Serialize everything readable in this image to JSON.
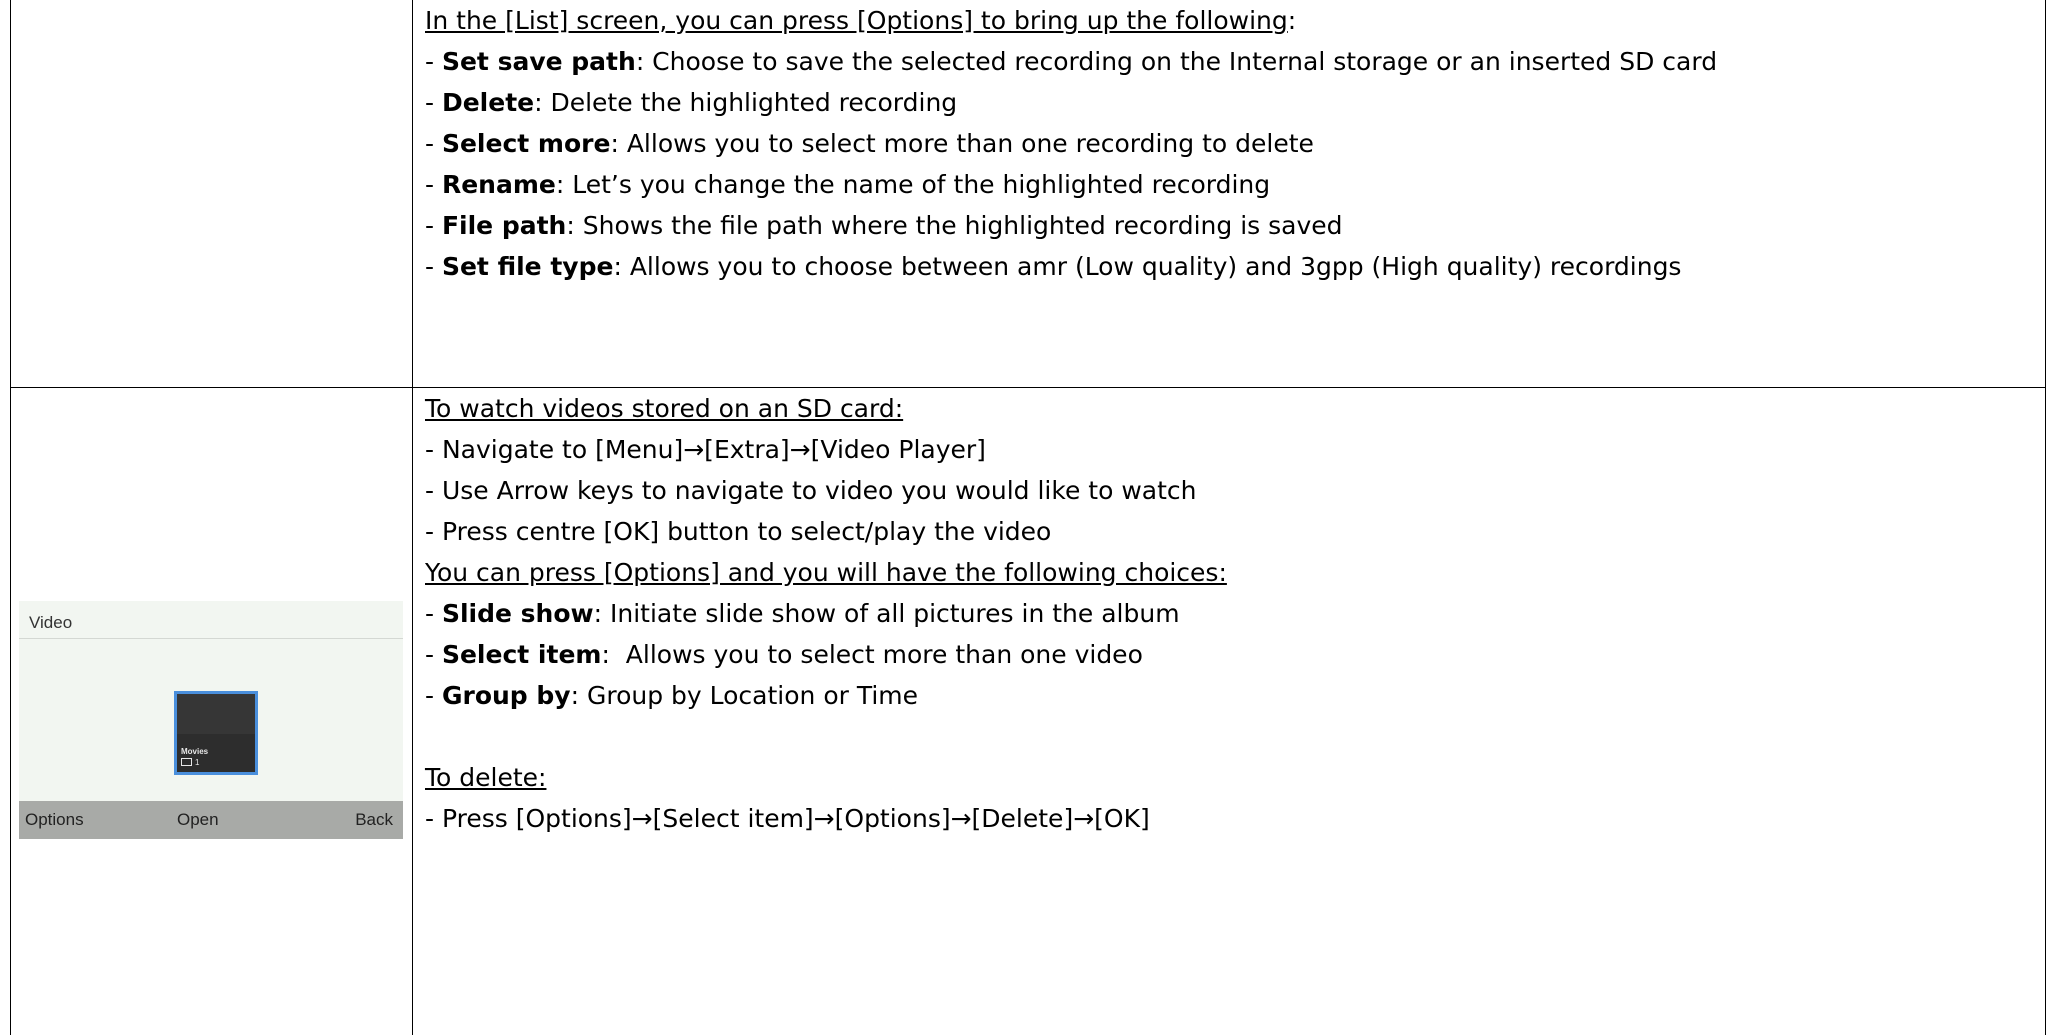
{
  "row1": {
    "lines": [
      {
        "type": "underlined",
        "text": "In the [List] screen, you can press [Options] to bring up the following",
        "suffix": ":"
      },
      {
        "type": "item",
        "prefix": "- ",
        "bold": "Set save path",
        "rest": ": Choose to save the selected recording on the Internal storage or an inserted SD card"
      },
      {
        "type": "item",
        "prefix": "- ",
        "bold": "Delete",
        "rest": ": Delete the highlighted recording"
      },
      {
        "type": "item",
        "prefix": "- ",
        "bold": "Select more",
        "rest": ": Allows you to select more than one recording to delete"
      },
      {
        "type": "item",
        "prefix": "- ",
        "bold": "Rename",
        "rest": ": Let’s you change the name of the highlighted recording"
      },
      {
        "type": "item",
        "prefix": "- ",
        "bold": "File path",
        "rest": ": Shows the file path where the highlighted recording is saved"
      },
      {
        "type": "item",
        "prefix": "- ",
        "bold": "Set file type",
        "rest": ": Allows you to choose between amr (Low quality) and 3gpp (High quality) recordings"
      }
    ]
  },
  "row2": {
    "lines": [
      {
        "type": "underlined",
        "text": "To watch videos stored on an SD card:",
        "suffix": ""
      },
      {
        "type": "plain",
        "text": "- Navigate to [Menu]→[Extra]→[Video Player]"
      },
      {
        "type": "plain",
        "text": "- Use Arrow keys to navigate to video you would like to watch"
      },
      {
        "type": "plain",
        "text": "- Press centre [OK] button to select/play the video"
      },
      {
        "type": "underlined",
        "text": "You can press [Options] and you will have the following choices:",
        "suffix": ""
      },
      {
        "type": "item",
        "prefix": "- ",
        "bold": "Slide show",
        "rest": ": Initiate slide show of all pictures in the album"
      },
      {
        "type": "item",
        "prefix": "- ",
        "bold": "Select item",
        "rest": ":  Allows you to select more than one video"
      },
      {
        "type": "item",
        "prefix": "- ",
        "bold": "Group by",
        "rest": ": Group by Location or Time"
      },
      {
        "type": "blank"
      },
      {
        "type": "underlined",
        "text": "To delete:",
        "suffix": ""
      },
      {
        "type": "plain",
        "text": "- Press [Options]→[Select item]→[Options]→[Delete]→[OK]"
      }
    ]
  },
  "phone": {
    "title": "Video",
    "folder_name": "Movies",
    "folder_count": "1",
    "softkey_left": "Options",
    "softkey_center": "Open",
    "softkey_right": "Back",
    "selection_color": "#4a8fdc",
    "folder_icon": "folder-icon"
  }
}
